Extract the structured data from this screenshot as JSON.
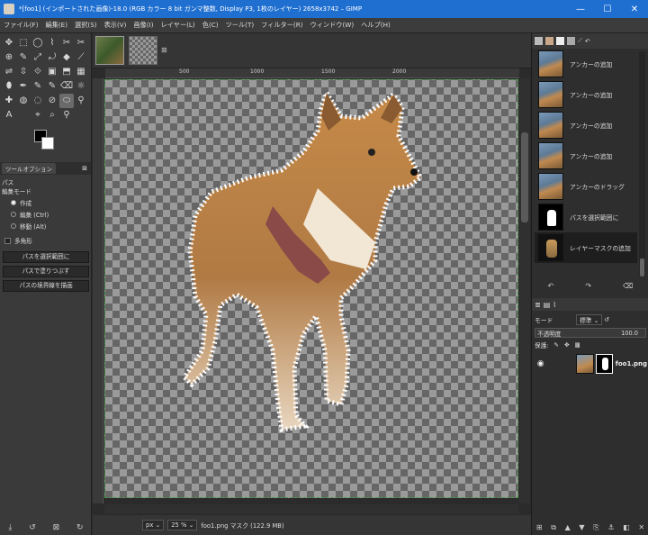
{
  "window": {
    "title": "*[foo1] (インポートされた画像)-18.0 (RGB カラー 8 bit ガンマ整数, Display P3, 1枚のレイヤー) 2658x3742 – GIMP",
    "minimize": "—",
    "maximize": "☐",
    "close": "✕"
  },
  "menu": [
    "ファイル(F)",
    "編集(E)",
    "選択(S)",
    "表示(V)",
    "画像(I)",
    "レイヤー(L)",
    "色(C)",
    "ツール(T)",
    "フィルター(R)",
    "ウィンドウ(W)",
    "ヘルプ(H)"
  ],
  "tool_icons": [
    "✥",
    "⬚",
    "◯",
    "⌇",
    "✂",
    "✂",
    "⊕",
    "✎",
    "⤢",
    "⤾",
    "◆",
    "⟋",
    "⇌",
    "⇳",
    "⟐",
    "▣",
    "⬒",
    "▦",
    "⬮",
    "✒",
    "✎",
    "✎",
    "⌫",
    "☼",
    "✚",
    "◍",
    "◌",
    "⊘",
    "⬭",
    "⚲",
    "A",
    "",
    "⌖",
    "⌕",
    "⚲"
  ],
  "tool_options": {
    "tab_label": "ツールオプション",
    "tab_close": "⊠",
    "title": "パス",
    "edit_mode_label": "編集モード",
    "mode_design": "作成",
    "mode_edit": "編集 (Ctrl)",
    "mode_move": "移動 (Alt)",
    "polygon_label": "多角形",
    "btn_selection": "パスを選択範囲に",
    "btn_fill": "パスで塗りつぶす",
    "btn_stroke": "パスの境界線を描画"
  },
  "image_tab_close": "⊠",
  "ruler_labels": [
    "500",
    "1000",
    "1500",
    "2000"
  ],
  "status": {
    "unit": "px ⌄",
    "zoom": "25 % ⌄",
    "text": "foo1.png マスク (122.9 MB)"
  },
  "history": {
    "items": [
      {
        "label": "アンカーの追加",
        "thumb": "photo"
      },
      {
        "label": "アンカーの追加",
        "thumb": "photo"
      },
      {
        "label": "アンカーの追加",
        "thumb": "photo"
      },
      {
        "label": "アンカーの追加",
        "thumb": "photo"
      },
      {
        "label": "アンカーのドラッグ",
        "thumb": "photo"
      },
      {
        "label": "パスを選択範囲に",
        "thumb": "mask"
      },
      {
        "label": "レイヤーマスクの追加",
        "thumb": "dog"
      }
    ]
  },
  "layers": {
    "mode_label": "モード",
    "mode_value": "標準 ⌄",
    "opacity_label": "不透明度",
    "opacity_value": "100.0",
    "lock_label": "保護:",
    "layer_name": "foo1.png"
  },
  "colors": {
    "titlebar": "#1f6fd1",
    "selection_dash": "#4a9a4a"
  }
}
